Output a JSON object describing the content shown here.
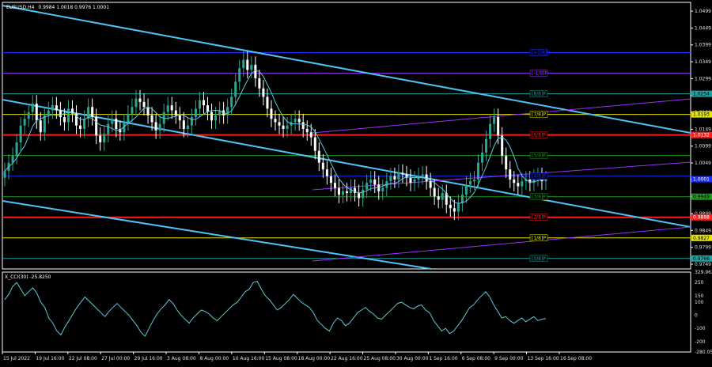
{
  "header": {
    "symbol": "EURUSD,H4",
    "ohlc": "0.9984 1.0018 0.9976 1.0001",
    "indicator": "X_CCI(30) -25.8250"
  },
  "colors": {
    "background": "#000000",
    "frame": "#ffffff",
    "bull_candle": "#2ea58f",
    "bear_candle": "#ffffff",
    "ma_line": "#5fc8d8",
    "channel_line": "#4fc3f7",
    "murrey_violet": "#9b30ff",
    "murrey_red": "#ff1b1b",
    "murrey_yellow": "#e6e600",
    "murrey_green": "#1e9a1e",
    "murrey_teal": "#1ea0a0",
    "murrey_blue": "#1a2dff",
    "cci_line": "#5fc8d8"
  },
  "chart_data": [
    {
      "type": "candlestick",
      "title": "EURUSD,H4",
      "ylim": [
        0.9735,
        1.0525
      ],
      "y_ticks": [
        "1.0499",
        "1.0449",
        "1.0399",
        "1.0349",
        "1.0299",
        "1.0249",
        "1.0199",
        "1.0149",
        "1.0099",
        "1.0049",
        "0.9999",
        "0.9949",
        "0.9899",
        "0.9849",
        "0.9799",
        "0.9749"
      ],
      "x_ticks": [
        "15 Jul 2022",
        "19 Jul 16:00",
        "22 Jul 08:00",
        "27 Jul 00:00",
        "29 Jul 16:00",
        "3 Aug 08:00",
        "8 Aug 00:00",
        "10 Aug 16:00",
        "15 Aug 08:00",
        "18 Aug 00:00",
        "22 Aug 16:00",
        "25 Aug 08:00",
        "30 Aug 00:00",
        "1 Sep 16:00",
        "6 Sep 08:00",
        "9 Sep 00:00",
        "13 Sep 16:00",
        "16 Sep 08:00"
      ],
      "close_series": [
        1.0025,
        1.005,
        1.007,
        1.011,
        1.016,
        1.018,
        1.02,
        1.0225,
        1.0175,
        1.014,
        1.019,
        1.0205,
        1.022,
        1.0205,
        1.0185,
        1.017,
        1.021,
        1.0195,
        1.016,
        1.015,
        1.018,
        1.0215,
        1.0185,
        1.013,
        1.011,
        1.0135,
        1.0165,
        1.018,
        1.015,
        1.014,
        1.017,
        1.0195,
        1.0215,
        1.024,
        1.023,
        1.0215,
        1.019,
        1.017,
        1.0145,
        1.0165,
        1.02,
        1.022,
        1.0205,
        1.019,
        1.0175,
        1.015,
        1.016,
        1.0185,
        1.021,
        1.0235,
        1.022,
        1.02,
        1.0175,
        1.019,
        1.0205,
        1.019,
        1.0215,
        1.0245,
        1.029,
        1.033,
        1.0355,
        1.0325,
        1.034,
        1.03,
        1.027,
        1.0245,
        1.021,
        1.018,
        1.017,
        1.016,
        1.015,
        1.016,
        1.017,
        1.018,
        1.017,
        1.015,
        1.014,
        1.0125,
        1.0085,
        1.005,
        1.003,
        1.001,
        0.999,
        0.9975,
        0.9955,
        0.9965,
        0.996,
        0.9975,
        0.996,
        0.9945,
        0.997,
        0.999,
        1.0,
        0.9985,
        0.9965,
        0.9975,
        0.9995,
        1.001,
        1.0,
        1.002,
        1.0015,
        1.0005,
        0.999,
        1.0,
        1.001,
        1.0015,
        0.9995,
        0.9975,
        0.995,
        0.994,
        0.996,
        0.9925,
        0.9915,
        0.9905,
        0.993,
        0.9955,
        0.9985,
        0.9995,
        1.0,
        1.005,
        1.008,
        1.012,
        1.0165,
        1.0185,
        1.013,
        1.007,
        1.003,
        1.0,
        0.999,
        0.998,
        0.9995,
        1.0,
        0.999,
        1.0005,
        1.001,
        0.9995,
        1.0001
      ],
      "murrey_levels": [
        {
          "label": "[8/8]P",
          "value": 1.0254,
          "color": "#1ea0a0"
        },
        {
          "label": "[7/8]P",
          "value": 1.0193,
          "color": "#e6e600"
        },
        {
          "label": "[6/8]P",
          "value": 1.0132,
          "color": "#ff1b1b"
        },
        {
          "label": "[5/8]P",
          "value": 1.0071,
          "color": "#1e9a1e"
        },
        {
          "label": "[4/8]P",
          "value": 1.001,
          "color": "#1a2dff"
        },
        {
          "label": "[3/8]P",
          "value": 0.9949,
          "color": "#1e9a1e"
        },
        {
          "label": "[2/8]P",
          "value": 0.9888,
          "color": "#ff1b1b"
        },
        {
          "label": "[1/8]P",
          "value": 0.9827,
          "color": "#e6e600"
        },
        {
          "label": "[0/8]P",
          "value": 0.9766,
          "color": "#1ea0a0"
        },
        {
          "label": "[-1/8]P",
          "value": 1.0315,
          "color": "#9b30ff"
        },
        {
          "label": "[+2/8]P",
          "value": 1.0376,
          "color": "#1a2dff"
        }
      ],
      "price_badges": [
        {
          "text": "1.0254",
          "value": 1.0254,
          "color": "#1ea0a0"
        },
        {
          "text": "1.0193",
          "value": 1.0193,
          "color": "#e6e600"
        },
        {
          "text": "1.0132",
          "value": 1.0132,
          "color": "#ff1b1b"
        },
        {
          "text": "1.0001",
          "value": 1.0001,
          "color": "#1a2dff"
        },
        {
          "text": "0.9949",
          "value": 0.9949,
          "color": "#1e9a1e"
        },
        {
          "text": "0.9888",
          "value": 0.9888,
          "color": "#ff1b1b"
        },
        {
          "text": "0.9827",
          "value": 0.9827,
          "color": "#e6e600"
        },
        {
          "text": "0.9766",
          "value": 0.9766,
          "color": "#1ea0a0"
        }
      ]
    },
    {
      "type": "line",
      "title": "X_CCI(30) -25.8250",
      "ylim": [
        -280,
        330
      ],
      "y_ticks": [
        "329.9622",
        "250",
        "150",
        "100",
        "0",
        "-100",
        "-200",
        "-280.0577"
      ],
      "values": [
        120,
        160,
        220,
        250,
        200,
        150,
        180,
        210,
        170,
        100,
        60,
        -20,
        -60,
        -120,
        -150,
        -90,
        -40,
        10,
        60,
        100,
        140,
        110,
        80,
        50,
        20,
        -10,
        30,
        60,
        90,
        60,
        30,
        0,
        -40,
        -80,
        -130,
        -160,
        -100,
        -40,
        10,
        50,
        80,
        120,
        90,
        40,
        0,
        -30,
        -60,
        -20,
        10,
        40,
        30,
        10,
        -20,
        -40,
        -10,
        20,
        50,
        80,
        100,
        140,
        180,
        200,
        250,
        260,
        200,
        150,
        120,
        80,
        40,
        60,
        90,
        120,
        160,
        130,
        100,
        80,
        60,
        20,
        -40,
        -70,
        -100,
        -120,
        -60,
        -20,
        -40,
        -80,
        -60,
        -20,
        20,
        40,
        60,
        30,
        10,
        -20,
        -30,
        0,
        30,
        60,
        90,
        100,
        80,
        60,
        50,
        70,
        80,
        40,
        20,
        -40,
        -80,
        -120,
        -100,
        -140,
        -120,
        -80,
        -40,
        10,
        60,
        80,
        120,
        150,
        180,
        140,
        80,
        30,
        -20,
        -10,
        -40,
        -60,
        -40,
        -20,
        -50,
        -30,
        -10,
        -40,
        -30,
        -25
      ]
    }
  ]
}
